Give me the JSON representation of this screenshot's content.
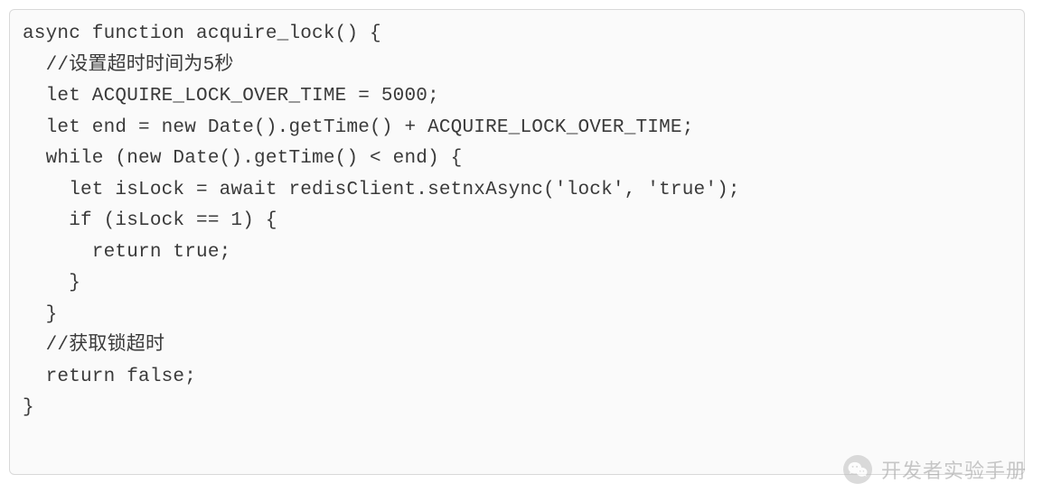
{
  "code": {
    "lines": [
      "async function acquire_lock() {",
      "  //设置超时时间为5秒",
      "  let ACQUIRE_LOCK_OVER_TIME = 5000;",
      "  let end = new Date().getTime() + ACQUIRE_LOCK_OVER_TIME;",
      "  while (new Date().getTime() < end) {",
      "    let isLock = await redisClient.setnxAsync('lock', 'true');",
      "    if (isLock == 1) {",
      "      return true;",
      "    }",
      "  }",
      "  //获取锁超时",
      "  return false;",
      "}"
    ]
  },
  "watermark": {
    "text": "开发者实验手册",
    "icon": "wechat-icon"
  }
}
